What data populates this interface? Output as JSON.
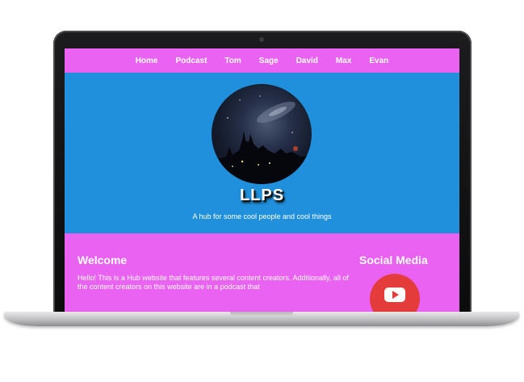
{
  "nav": {
    "items": [
      "Home",
      "Podcast",
      "Tom",
      "Sage",
      "David",
      "Max",
      "Evan"
    ]
  },
  "hero": {
    "title": "LLPS",
    "tagline": "A hub for some cool people and cool things"
  },
  "welcome": {
    "heading": "Welcome",
    "text": "Hello! This is a Hub website that features several content creators. Additionally, all of the content creators on this website are in a podcast that"
  },
  "social": {
    "heading": "Social Media",
    "icon": "youtube-icon"
  },
  "colors": {
    "nav_bg": "#e962f2",
    "hero_bg": "#2190dc",
    "content_bg": "#e962f2",
    "youtube_red": "#e43b3b"
  }
}
